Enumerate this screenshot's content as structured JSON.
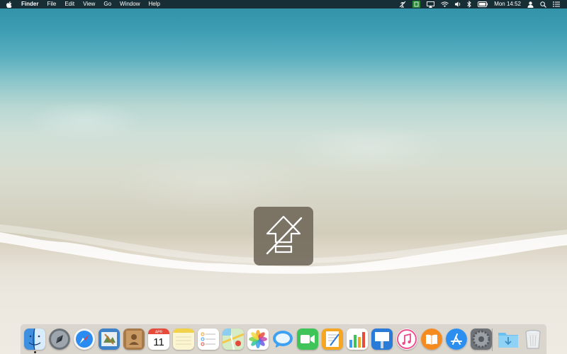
{
  "menubar": {
    "apple_icon": "apple-logo-icon",
    "app_name": "Finder",
    "menus": [
      "File",
      "Edit",
      "View",
      "Go",
      "Window",
      "Help"
    ],
    "status_icons": [
      "antenna-off-icon",
      "battery-app-icon",
      "airplay-icon",
      "wifi-icon",
      "volume-icon",
      "bluetooth-icon",
      "keyboard-battery-icon"
    ],
    "clock": "Mon 14:52",
    "user_icon": "user-icon",
    "spotlight_icon": "search-icon",
    "notification_icon": "notification-list-icon"
  },
  "hud": {
    "icon": "caps-lock-off-icon"
  },
  "dock": {
    "calendar_month": "APR",
    "calendar_day": "11",
    "apps": [
      "Finder",
      "Launchpad",
      "Safari",
      "Mail",
      "Contacts",
      "Calendar",
      "Notes",
      "Reminders",
      "Maps",
      "Photos",
      "Messages",
      "FaceTime",
      "Pages",
      "Numbers",
      "Keynote",
      "iTunes",
      "iBooks",
      "App Store",
      "System Preferences",
      "Downloads",
      "Trash"
    ]
  },
  "colors": {
    "menubar_bg": "#142026",
    "hud_bg": "#6e6658",
    "water_deep": "#2f8fa5",
    "sand": "#ece8e0"
  }
}
